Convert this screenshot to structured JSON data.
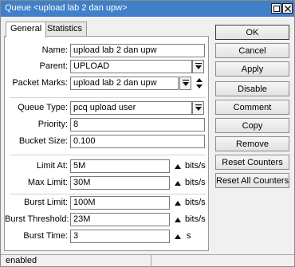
{
  "window": {
    "title": "Queue <upload lab 2 dan upw>"
  },
  "tabs": [
    {
      "label": "General",
      "active": true
    },
    {
      "label": "Statistics",
      "active": false
    }
  ],
  "form": {
    "name": {
      "label": "Name:",
      "value": "upload lab 2 dan upw"
    },
    "parent": {
      "label": "Parent:",
      "value": "UPLOAD"
    },
    "packet_marks": {
      "label": "Packet Marks:",
      "value": "upload lab 2 dan upw"
    },
    "queue_type": {
      "label": "Queue Type:",
      "value": "pcq upload user"
    },
    "priority": {
      "label": "Priority:",
      "value": "8"
    },
    "bucket_size": {
      "label": "Bucket Size:",
      "value": "0.100"
    },
    "limit_at": {
      "label": "Limit At:",
      "value": "5M",
      "unit": "bits/s"
    },
    "max_limit": {
      "label": "Max Limit:",
      "value": "30M",
      "unit": "bits/s"
    },
    "burst_limit": {
      "label": "Burst Limit:",
      "value": "100M",
      "unit": "bits/s"
    },
    "burst_threshold": {
      "label": "Burst Threshold:",
      "value": "23M",
      "unit": "bits/s"
    },
    "burst_time": {
      "label": "Burst Time:",
      "value": "3",
      "unit": "s"
    }
  },
  "buttons": {
    "ok": "OK",
    "cancel": "Cancel",
    "apply": "Apply",
    "disable": "Disable",
    "comment": "Comment",
    "copy": "Copy",
    "remove": "Remove",
    "reset_counters": "Reset Counters",
    "reset_all_counters": "Reset All Counters"
  },
  "status": {
    "text": "enabled"
  },
  "colors": {
    "titlebar": "#3f80c8",
    "panel_bg": "#ffffff",
    "window_bg": "#f0f0f0"
  }
}
